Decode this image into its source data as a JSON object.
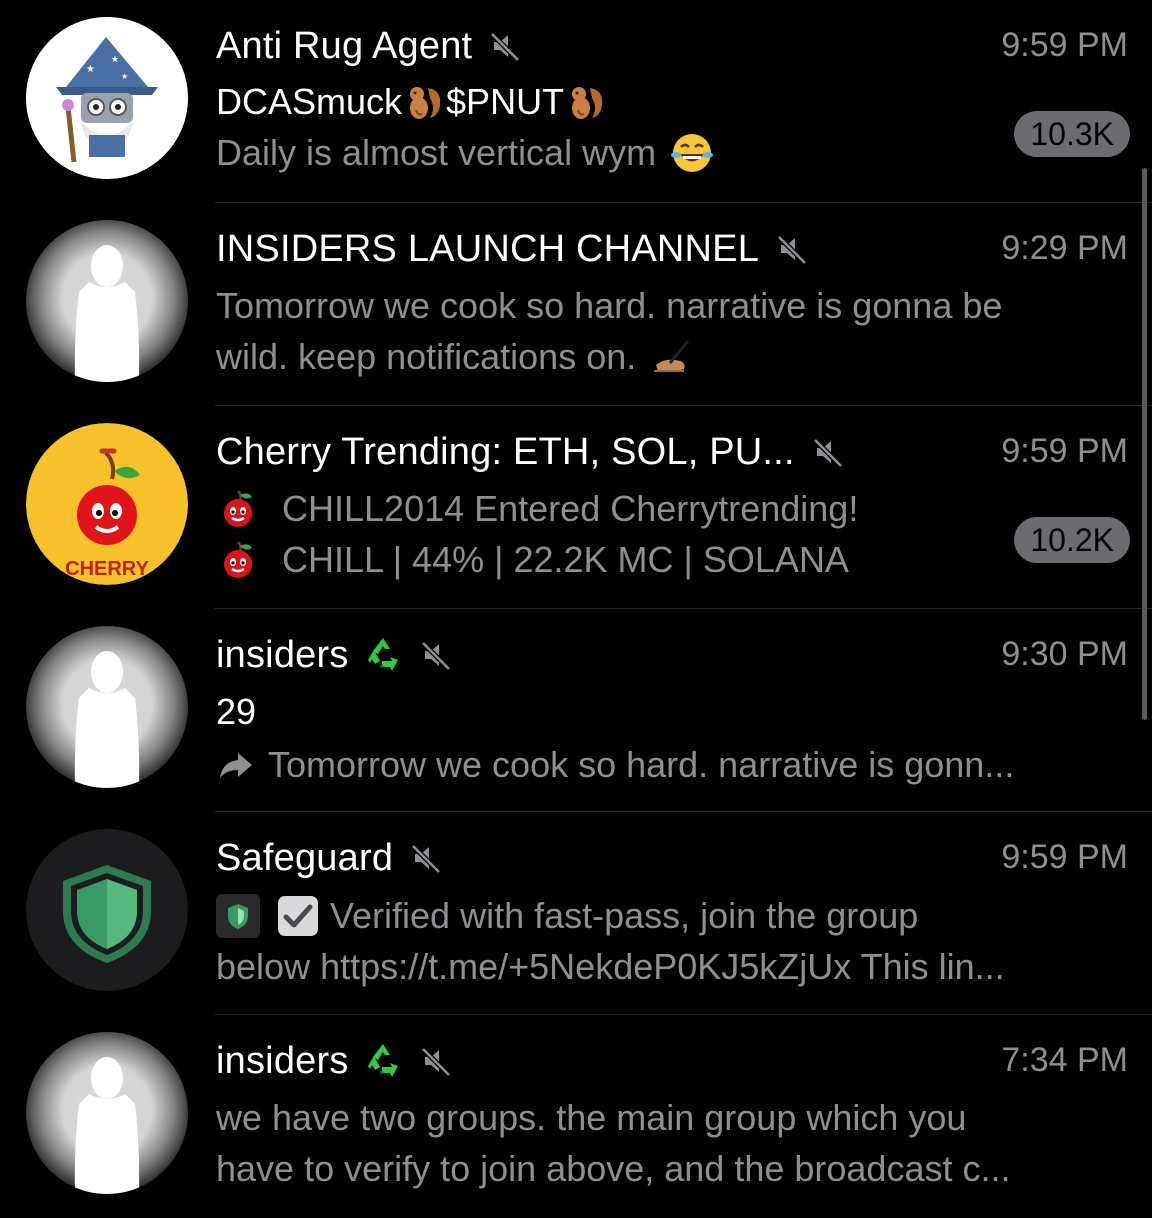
{
  "chats": [
    {
      "title": "Anti Rug Agent",
      "time": "9:59 PM",
      "sender_prefix": "DCASmuck",
      "sender_suffix": "$PNUT",
      "preview": "Daily is almost vertical wym",
      "unread_badge": "10.3K",
      "avatar_icon": "wizard-robot-icon",
      "muted": true
    },
    {
      "title": "INSIDERS LAUNCH CHANNEL",
      "time": "9:29 PM",
      "preview_line1": "Tomorrow we cook so hard. narrative is gonna be",
      "preview_line2": "wild. keep notifications on.",
      "avatar_icon": "person-silhouette-icon",
      "muted": true
    },
    {
      "title": "Cherry Trending: ETH, SOL, PU...",
      "time": "9:59 PM",
      "preview_line1": "CHILL2014 Entered Cherrytrending!",
      "preview_line2": "CHILL | 44% |  22.2K MC | SOLANA",
      "avatar_label": "CHERRY",
      "unread_badge": "10.2K",
      "avatar_icon": "cherry-icon",
      "muted": true
    },
    {
      "title": "insiders",
      "time": "9:30 PM",
      "sender": "29",
      "preview": "Tomorrow we cook so hard. narrative is gonn...",
      "avatar_icon": "person-silhouette-icon",
      "muted": true
    },
    {
      "title": "Safeguard",
      "time": "9:59 PM",
      "preview_line1": "Verified with fast-pass, join the group",
      "preview_line2": "below https://t.me/+5NekdeP0KJ5kZjUx This lin...",
      "avatar_icon": "shield-icon",
      "muted": true
    },
    {
      "title": "insiders",
      "time": "7:34 PM",
      "preview_line1": "we have two groups. the main group which you",
      "preview_line2": "have to verify to join above, and the broadcast c...",
      "avatar_icon": "person-silhouette-icon",
      "muted": true
    }
  ],
  "colors": {
    "background": "#000000",
    "title": "#ffffff",
    "secondary_text": "#8e8e93",
    "badge_bg": "#6c6c70",
    "divider": "#2a2a2c",
    "recycle_green": "#2ecc40",
    "cherry_yellow": "#f6c12a",
    "shield_green": "#3a9a66"
  }
}
